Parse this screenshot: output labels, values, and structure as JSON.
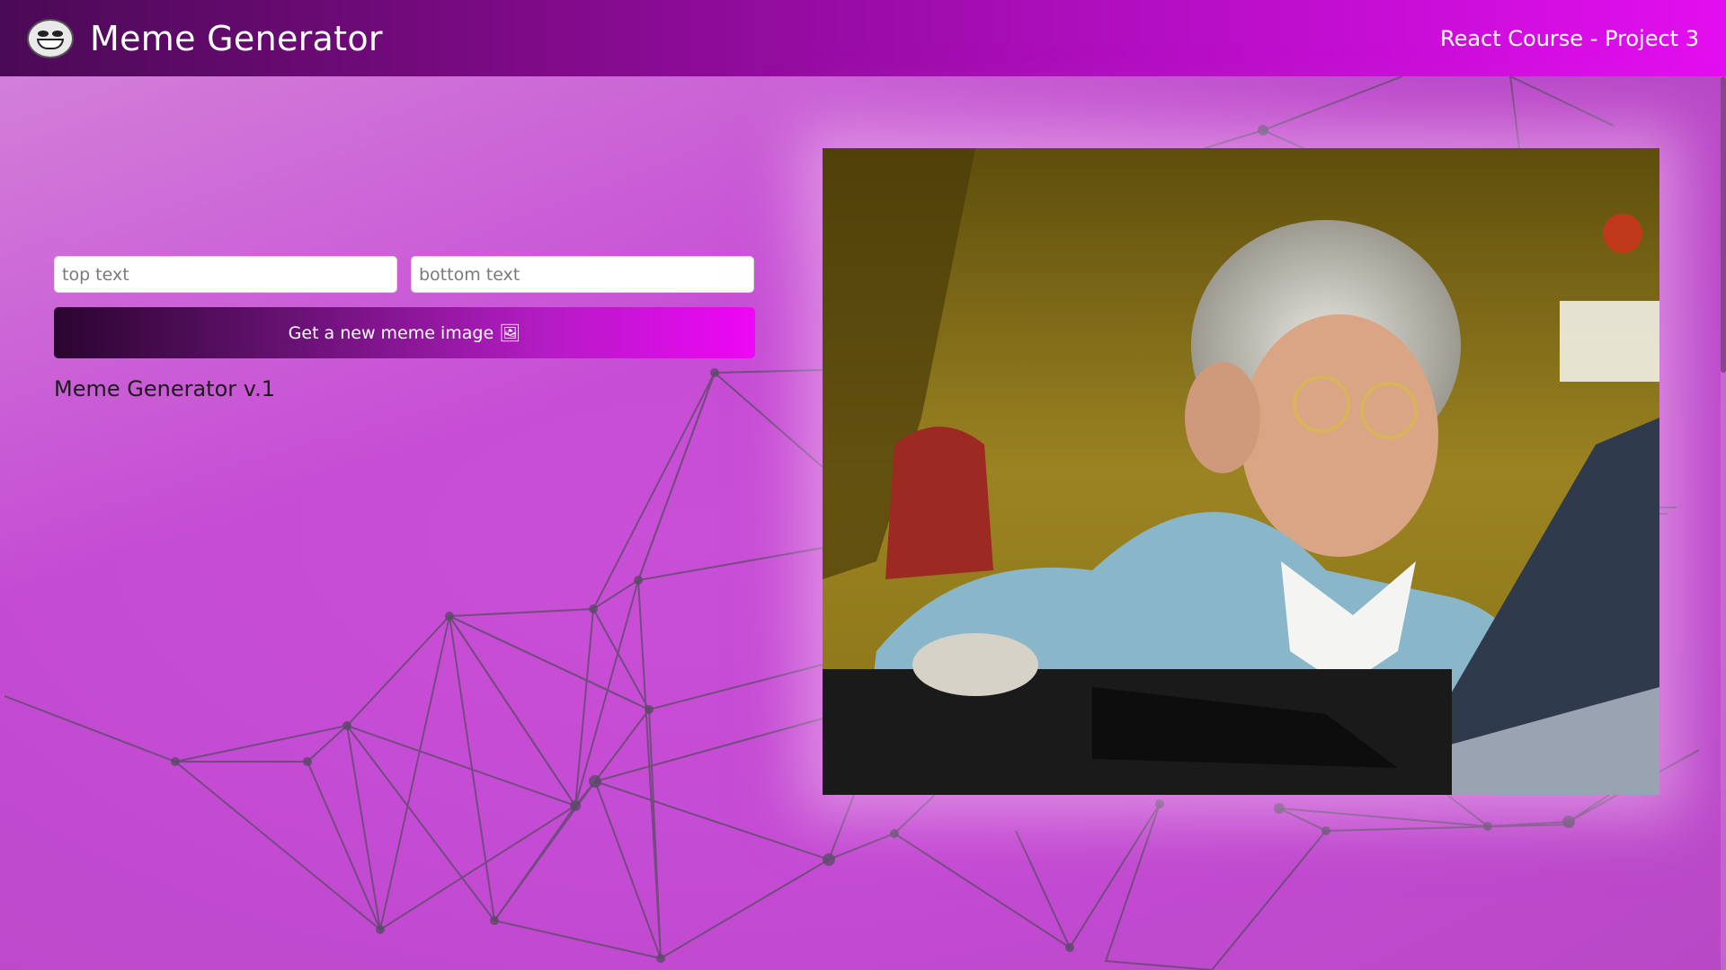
{
  "header": {
    "title": "Meme Generator",
    "subtitle": "React Course - Project 3",
    "logo_icon": "troll-face-icon"
  },
  "form": {
    "top_placeholder": "top text",
    "top_value": "",
    "bottom_placeholder": "bottom text",
    "bottom_value": "",
    "button_label": "Get a new meme image 🖼"
  },
  "version_label": "Meme Generator v.1",
  "meme": {
    "alt": "Grandma using a laptop meme",
    "top_text": "",
    "bottom_text": ""
  },
  "colors": {
    "header_gradient_start": "#4a0a55",
    "header_gradient_end": "#e30ef0",
    "background": "#c44bd3",
    "button_gradient_start": "#2a0530",
    "button_gradient_end": "#ee06f6"
  }
}
